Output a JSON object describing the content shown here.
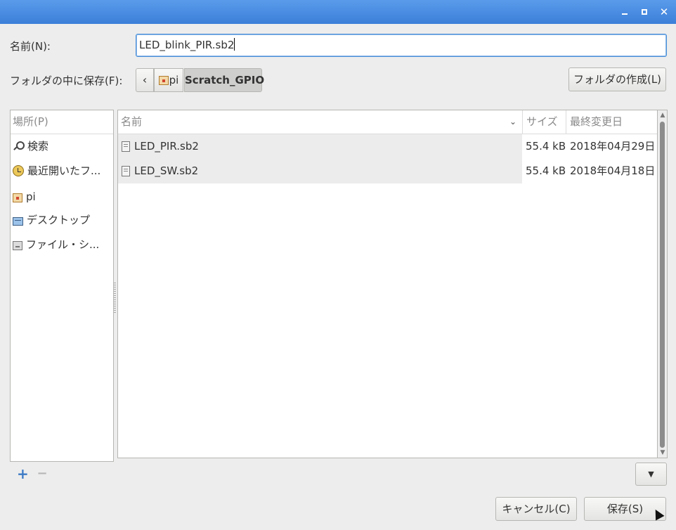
{
  "window": {
    "controls": {
      "minimize": "minimize-icon",
      "maximize": "maximize-icon",
      "close": "✕"
    }
  },
  "name_field": {
    "label": "名前(N):",
    "value": "LED_blink_PIR.sb2"
  },
  "save_in": {
    "label": "フォルダの中に保存(F):",
    "back_icon": "‹",
    "path": [
      "pi",
      "Scratch_GPIO"
    ],
    "create_folder_label": "フォルダの作成(L)"
  },
  "places": {
    "header": "場所(P)",
    "items": [
      {
        "label": "検索",
        "icon": "search-icon"
      },
      {
        "label": "最近開いたフ...",
        "icon": "recent-icon"
      },
      {
        "label": "pi",
        "icon": "home-folder-icon"
      },
      {
        "label": "デスクトップ",
        "icon": "desktop-icon"
      },
      {
        "label": "ファイル・シ...",
        "icon": "filesystem-icon"
      }
    ],
    "add_label": "+",
    "remove_label": "−"
  },
  "files": {
    "columns": {
      "name": "名前",
      "size": "サイズ",
      "modified": "最終変更日"
    },
    "sort_indicator": "⌄",
    "rows": [
      {
        "name": "LED_PIR.sb2",
        "size": "55.4 kB",
        "modified": "2018年04月29日"
      },
      {
        "name": "LED_SW.sb2",
        "size": "55.4 kB",
        "modified": "2018年04月18日"
      }
    ]
  },
  "filter_dropdown": {
    "arrow": "▼"
  },
  "actions": {
    "cancel_label": "キャンセル(C)",
    "save_label": "保存(S)"
  },
  "colors": {
    "titlebar": "#4a8fe2",
    "focus_border": "#4a90d9",
    "add_icon": "#3d7bc6"
  }
}
